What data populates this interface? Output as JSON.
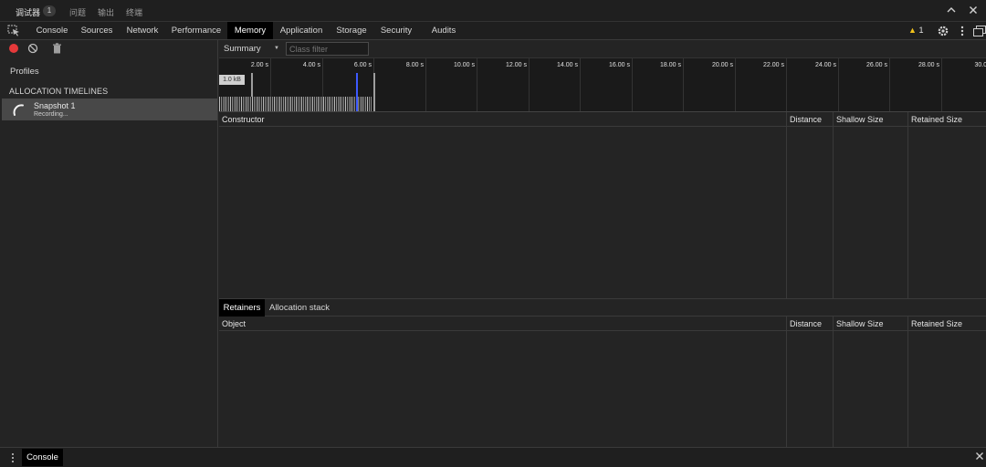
{
  "topbar": {
    "tabs": [
      {
        "label": "调试器"
      },
      {
        "label": "问题"
      },
      {
        "label": "输出"
      },
      {
        "label": "终端"
      }
    ],
    "badge": "1"
  },
  "main_tabs": {
    "items": [
      "Console",
      "Sources",
      "Network",
      "Performance",
      "Memory",
      "Application",
      "Storage",
      "Security",
      "Audits"
    ],
    "active": "Memory",
    "warning_count": "1"
  },
  "sidebar": {
    "profiles_label": "Profiles",
    "section_header": "ALLOCATION TIMELINES",
    "snapshot": {
      "title": "Snapshot 1",
      "status": "Recording..."
    }
  },
  "toolbar": {
    "view": "Summary",
    "filter_placeholder": "Class filter"
  },
  "timeline": {
    "tick_labels": [
      "2.00 s",
      "4.00 s",
      "6.00 s",
      "8.00 s",
      "10.00 s",
      "12.00 s",
      "14.00 s",
      "16.00 s",
      "18.00 s",
      "20.00 s",
      "22.00 s",
      "24.00 s",
      "26.00 s",
      "28.00 s",
      "30.00"
    ],
    "scale_label": "1.0 kB"
  },
  "constructor_grid": {
    "columns": [
      "Constructor",
      "Distance",
      "Shallow Size",
      "Retained Size"
    ]
  },
  "bottom_tabs": {
    "items": [
      "Retainers",
      "Allocation stack"
    ],
    "active": "Retainers"
  },
  "object_grid": {
    "columns": [
      "Object",
      "Distance",
      "Shallow Size",
      "Retained Size"
    ]
  },
  "drawer": {
    "tab": "Console"
  },
  "colors": {
    "record": "#e5393a",
    "warning": "#f1c21b",
    "timeline_cursor": "#3d5afe"
  }
}
